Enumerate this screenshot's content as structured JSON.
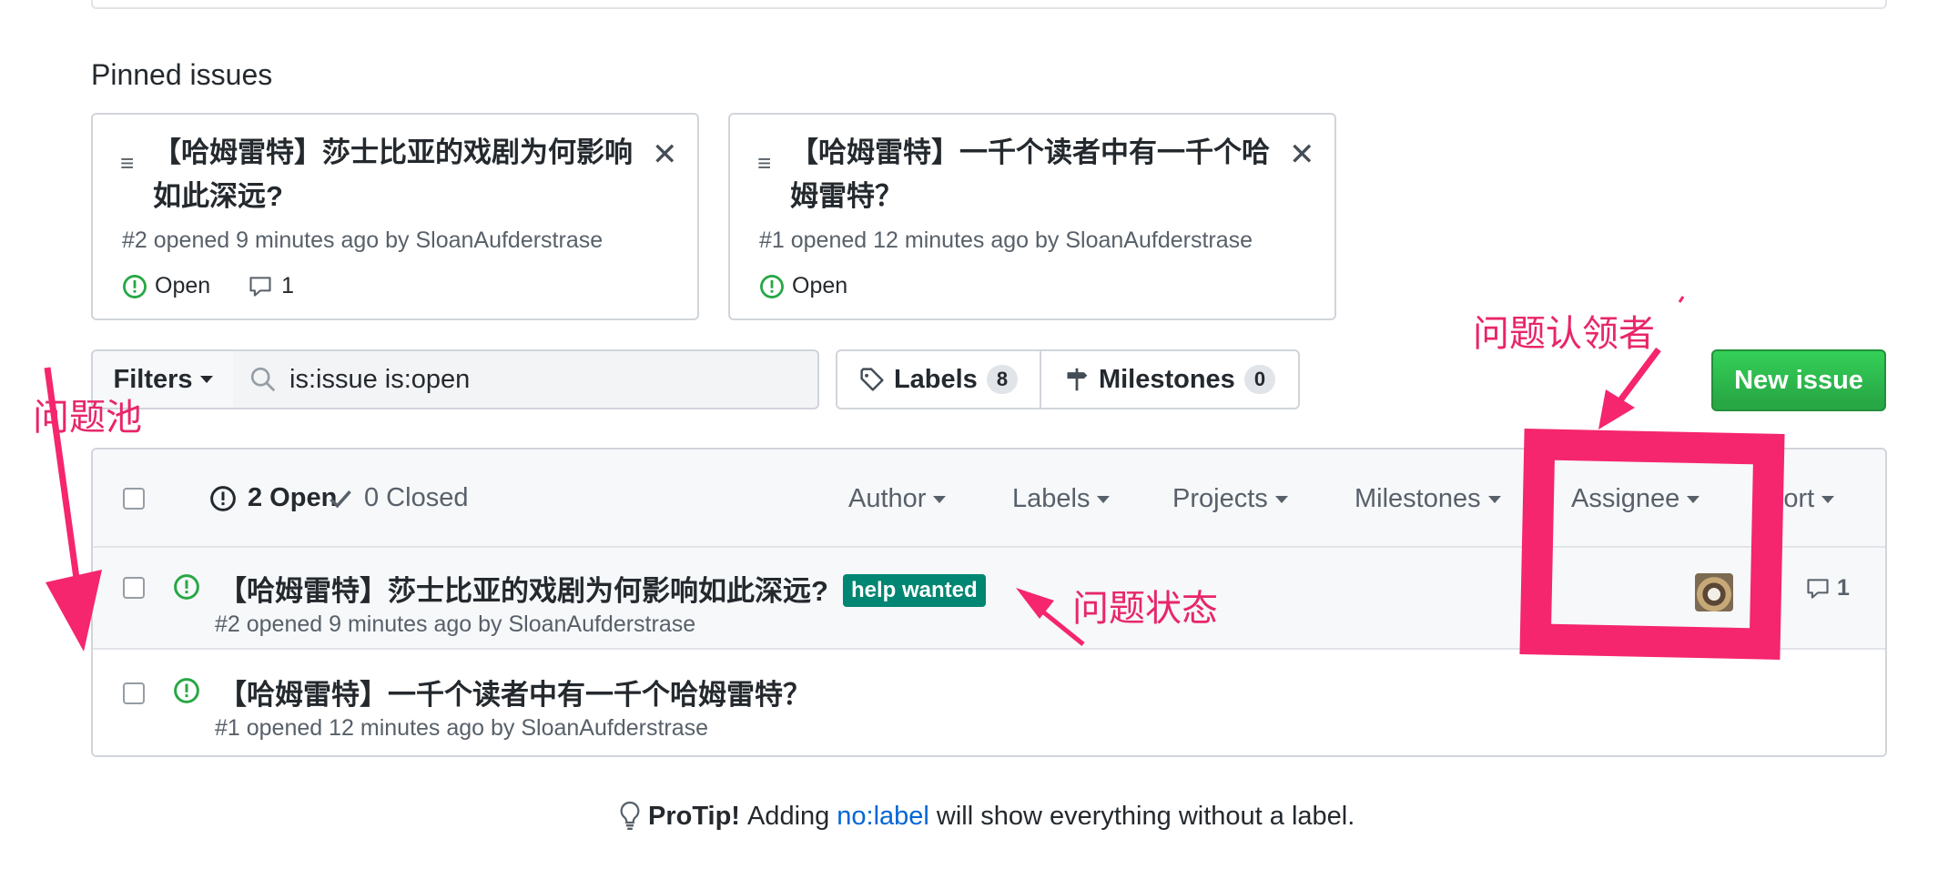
{
  "pinned": {
    "heading": "Pinned issues",
    "cards": [
      {
        "title": "【哈姆雷特】莎士比亚的戏剧为何影响如此深远?",
        "meta": "#2 opened 9 minutes ago by SloanAufderstrase",
        "status": "Open",
        "comments": "1"
      },
      {
        "title": "【哈姆雷特】一千个读者中有一千个哈姆雷特？",
        "meta": "#1 opened 12 minutes ago by SloanAufderstrase",
        "status": "Open"
      }
    ]
  },
  "toolbar": {
    "filters_label": "Filters",
    "search_value": "is:issue is:open",
    "labels_label": "Labels",
    "labels_count": "8",
    "milestones_label": "Milestones",
    "milestones_count": "0",
    "new_issue_label": "New issue"
  },
  "list_header": {
    "open_label": "2 Open",
    "closed_label": "0 Closed",
    "filters": [
      "Author",
      "Labels",
      "Projects",
      "Milestones",
      "Assignee",
      "Sort"
    ]
  },
  "issues": [
    {
      "title": "【哈姆雷特】莎士比亚的戏剧为何影响如此深远?",
      "label": "help wanted",
      "label_color": "#008672",
      "meta": "#2 opened 9 minutes ago by SloanAufderstrase",
      "comments": "1",
      "has_assignee": true
    },
    {
      "title": "【哈姆雷特】一千个读者中有一千个哈姆雷特？",
      "meta": "#1 opened 12 minutes ago by SloanAufderstrase"
    }
  ],
  "protip": {
    "lead": "ProTip!",
    "pre": "Adding",
    "link": "no:label",
    "post": "will show everything without a label."
  },
  "annotations": {
    "pool": "问题池",
    "status": "问题状态",
    "assignee": "问题认领者",
    "color": "#f5256e"
  },
  "colors": {
    "open_green": "#28a745",
    "link_blue": "#0366d6",
    "button_green": "#2cbe4e"
  }
}
